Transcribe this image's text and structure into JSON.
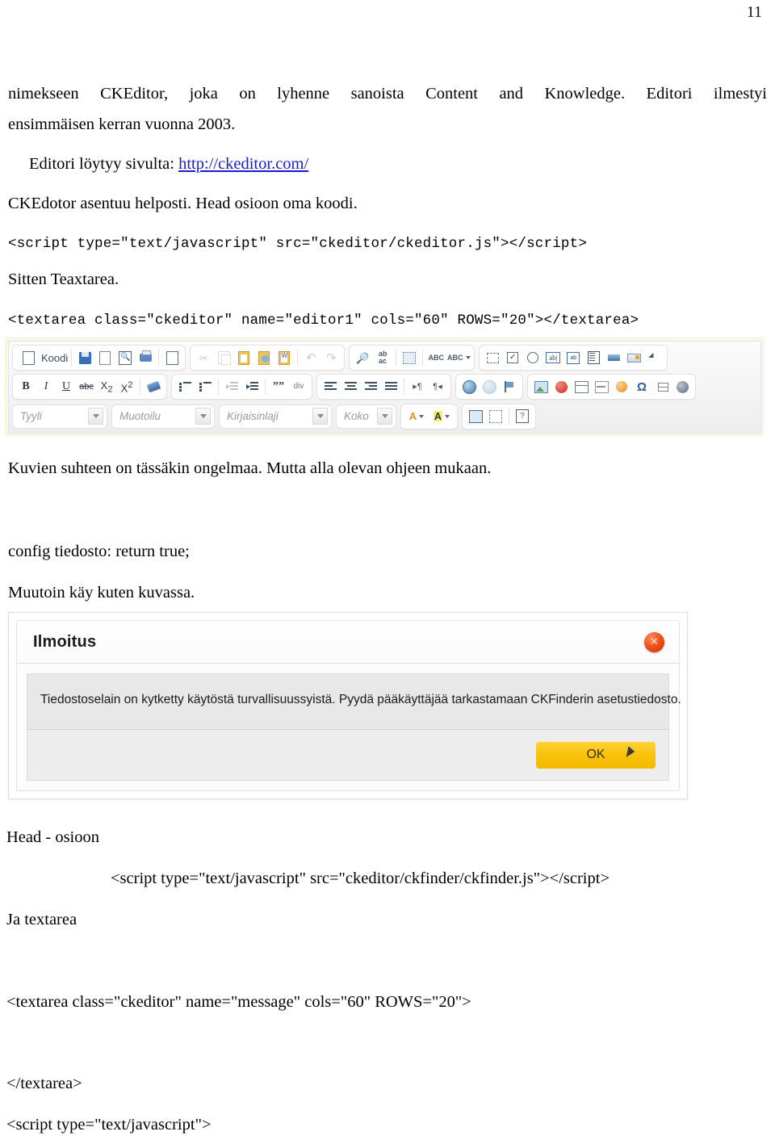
{
  "page": {
    "number": "11"
  },
  "content": {
    "p1": "nimekseen CKEditor, joka on lyhenne sanoista Content and Knowledge. Editori ilmestyi",
    "p1b": "ensimmäisen kerran vuonna 2003.",
    "p2_prefix": "Editori löytyy sivulta: ",
    "p2_link": "http://ckeditor.com/",
    "p3": "CKEdotor asentuu helposti. Head osioon oma koodi.",
    "code1": "<script type=\"text/javascript\" src=\"ckeditor/ckeditor.js\"></script>",
    "p4": "Sitten Teaxtarea.",
    "code2": "<textarea class=\"ckeditor\" name=\"editor1\" cols=\"60\" ROWS=\"20\"></textarea>",
    "p5": "Kuvien suhteen on tässäkin ongelmaa. Mutta alla olevan ohjeen mukaan.",
    "p6": "config tiedosto: return true;",
    "p7": "Muutoin käy kuten kuvassa.",
    "p8": "Head - osioon",
    "code3": "<script type=\"text/javascript\" src=\"ckeditor/ckfinder/ckfinder.js\"></script>",
    "p9": "Ja textarea",
    "code4": "<textarea class=\"ckeditor\" name=\"message\" cols=\"60\" ROWS=\"20\">",
    "code5": "</textarea>",
    "code6": "<script type=\"text/javascript\">"
  },
  "editor_toolbar": {
    "source_label": "Koodi",
    "combos": [
      {
        "name": "style",
        "label": "Tyyli"
      },
      {
        "name": "format",
        "label": "Muotoilu"
      },
      {
        "name": "font",
        "label": "Kirjaisinlaji"
      },
      {
        "name": "fontsize",
        "label": "Koko"
      }
    ],
    "row1_groups": [
      {
        "buttons": [
          {
            "icon": "source-icon",
            "label": "Koodi"
          },
          {
            "icon": "save-icon"
          },
          {
            "icon": "new-page-icon"
          },
          {
            "icon": "preview-icon"
          },
          {
            "icon": "print-icon"
          },
          {
            "icon": "templates-icon"
          }
        ]
      },
      {
        "buttons": [
          {
            "icon": "cut-icon"
          },
          {
            "icon": "copy-icon"
          },
          {
            "icon": "paste-icon"
          },
          {
            "icon": "paste-text-icon"
          },
          {
            "icon": "paste-from-word-icon"
          },
          {
            "icon": "undo-icon"
          },
          {
            "icon": "redo-icon"
          }
        ]
      },
      {
        "buttons": [
          {
            "icon": "find-icon"
          },
          {
            "icon": "replace-icon"
          },
          {
            "icon": "select-all-icon"
          },
          {
            "icon": "spellcheck-icon"
          },
          {
            "icon": "scayt-icon"
          }
        ]
      },
      {
        "buttons": [
          {
            "icon": "form-icon"
          },
          {
            "icon": "checkbox-icon"
          },
          {
            "icon": "radio-icon"
          },
          {
            "icon": "textfield-icon"
          },
          {
            "icon": "textarea-icon"
          },
          {
            "icon": "select-field-icon"
          },
          {
            "icon": "button-icon"
          },
          {
            "icon": "image-button-icon"
          },
          {
            "icon": "hidden-field-icon"
          }
        ]
      }
    ],
    "row2_groups": [
      {
        "buttons": [
          {
            "icon": "bold-icon",
            "glyph": "B"
          },
          {
            "icon": "italic-icon",
            "glyph": "I"
          },
          {
            "icon": "underline-icon",
            "glyph": "U"
          },
          {
            "icon": "strike-icon",
            "glyph": "abc"
          },
          {
            "icon": "subscript-icon",
            "glyph": "X₂"
          },
          {
            "icon": "superscript-icon",
            "glyph": "X²"
          },
          {
            "icon": "remove-format-icon"
          }
        ]
      },
      {
        "buttons": [
          {
            "icon": "numbered-list-icon"
          },
          {
            "icon": "bulleted-list-icon"
          },
          {
            "icon": "outdent-icon"
          },
          {
            "icon": "indent-icon"
          },
          {
            "icon": "blockquote-icon",
            "glyph": "99"
          },
          {
            "icon": "create-div-icon",
            "glyph": "div"
          }
        ]
      },
      {
        "buttons": [
          {
            "icon": "align-left-icon"
          },
          {
            "icon": "align-center-icon"
          },
          {
            "icon": "align-right-icon"
          },
          {
            "icon": "align-justify-icon"
          },
          {
            "icon": "ltr-icon"
          },
          {
            "icon": "rtl-icon"
          }
        ]
      },
      {
        "buttons": [
          {
            "icon": "link-icon"
          },
          {
            "icon": "unlink-icon"
          },
          {
            "icon": "anchor-icon"
          }
        ]
      },
      {
        "buttons": [
          {
            "icon": "image-icon"
          },
          {
            "icon": "flash-icon"
          },
          {
            "icon": "table-icon"
          },
          {
            "icon": "horizontal-rule-icon"
          },
          {
            "icon": "smiley-icon"
          },
          {
            "icon": "special-char-icon",
            "glyph": "Ω"
          },
          {
            "icon": "page-break-icon"
          },
          {
            "icon": "iframe-icon"
          }
        ]
      }
    ],
    "row3_groups": [
      {
        "buttons": [
          {
            "icon": "text-color-icon",
            "glyph": "A"
          },
          {
            "icon": "bg-color-icon",
            "glyph": "A"
          }
        ]
      },
      {
        "buttons": [
          {
            "icon": "maximize-icon"
          },
          {
            "icon": "show-blocks-icon"
          },
          {
            "icon": "about-icon",
            "glyph": "?"
          }
        ]
      }
    ]
  },
  "dialog": {
    "title": "Ilmoitus",
    "close_label": "✕",
    "message": "Tiedostoselain on kytketty käytöstä turvallisuussyistä. Pyydä pääkäyttäjää tarkastamaan CKFinderin asetustiedosto.",
    "ok_label": "OK"
  }
}
